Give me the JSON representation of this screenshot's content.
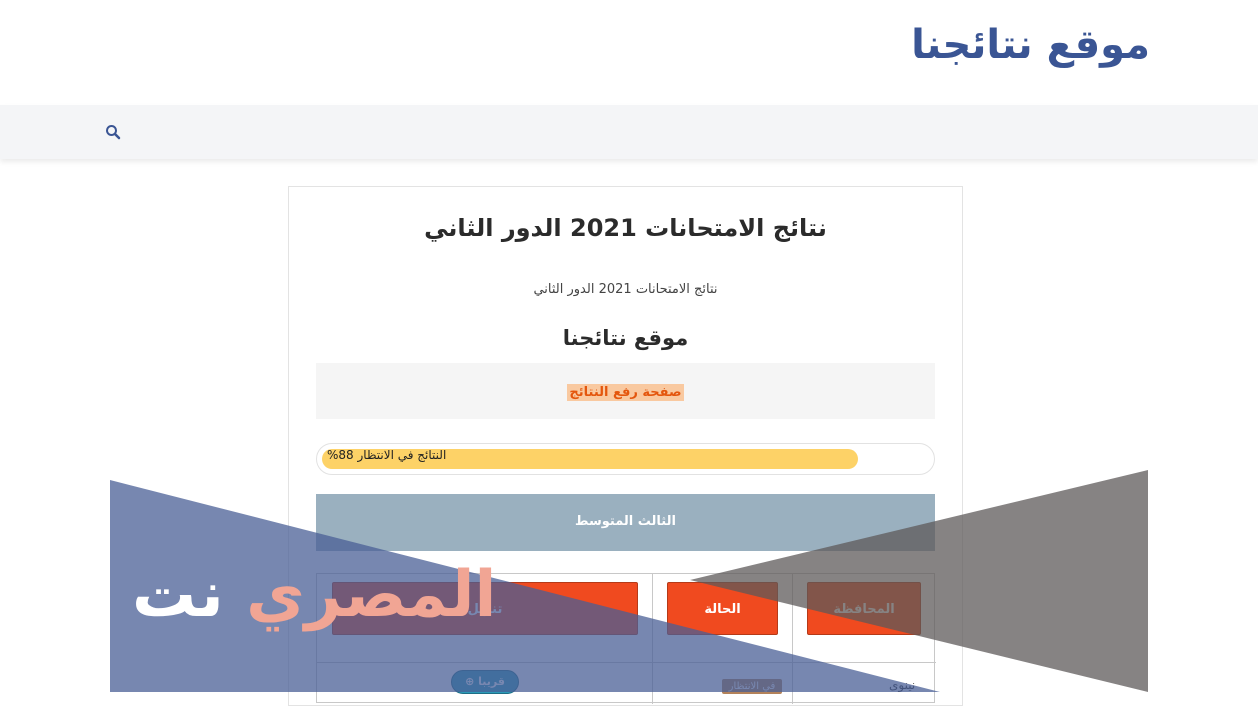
{
  "header": {
    "site_title": "موقع نتائجنا"
  },
  "nav": {
    "search_icon": "search-icon"
  },
  "post": {
    "title": "نتائج الامتحانات 2021 الدور الثاني",
    "subtitle": "نتائج الامتحانات 2021 الدور الثاني",
    "section_heading": "موقع نتائجنا",
    "upload_link": "صفحة رفع النتائج",
    "progress": {
      "label": "النتائج في الانتظار 88%",
      "percent": 88
    },
    "grade_label": "الثالث المتوسط"
  },
  "table": {
    "headers": [
      "المحافظة",
      "الحالة",
      "تنزيل"
    ],
    "rows": [
      {
        "province": "نينوى",
        "status": "في الانتظار",
        "action": "قريبا"
      }
    ]
  },
  "watermark": {
    "text_white": "نت",
    "text_pink": "المصري"
  },
  "colors": {
    "brand": "#3a5594",
    "accent_orange": "#f04a1f",
    "progress": "#fdd267",
    "grade_bar": "#9ab0bf",
    "watermark_blue": "#4a5f96"
  }
}
